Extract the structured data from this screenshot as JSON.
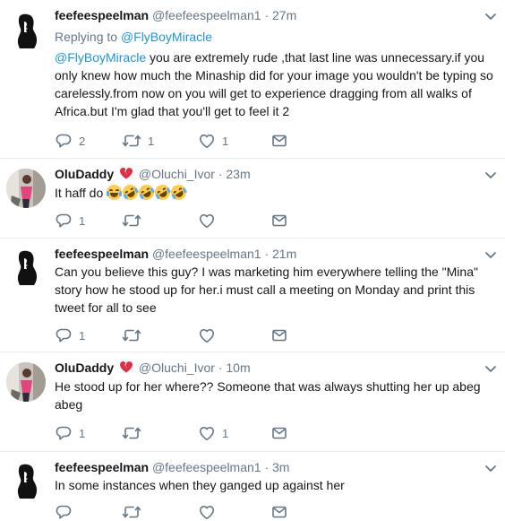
{
  "tweets": [
    {
      "name": "feefeespeelman",
      "handle": "@feefeespeelman1",
      "time": "· 27m",
      "replying_label": "Replying to",
      "replying_user": "@FlyBoyMiracle",
      "mention": "@FlyBoyMiracle",
      "text": " you are extremely rude ,that last line was unnecessary.if you only knew how much the Minaship did for your image you wouldn't be typing so carelessly.from now on you will get to experience dragging from all walks of Africa.but I'm glad that you'll get to feel it 2",
      "replies": "2",
      "retweets": "1",
      "likes": "1"
    },
    {
      "name": "OluDaddy",
      "handle": "@Oluchi_Ivor",
      "time": "· 23m",
      "text": "It haff do",
      "replies": "1",
      "retweets": "",
      "likes": ""
    },
    {
      "name": "feefeespeelman",
      "handle": "@feefeespeelman1",
      "time": "· 21m",
      "text": "Can you believe this guy? I was marketing him everywhere telling the \"Mina\" story how he stood up for her.i must call a meeting on Monday and print this tweet for all to see",
      "replies": "1",
      "retweets": "",
      "likes": ""
    },
    {
      "name": "OluDaddy",
      "handle": "@Oluchi_Ivor",
      "time": "· 10m",
      "text": "He stood up for her where?? Someone that was always shutting her up  abeg abeg",
      "replies": "1",
      "retweets": "",
      "likes": "1"
    },
    {
      "name": "feefeespeelman",
      "handle": "@feefeespeelman1",
      "time": "· 3m",
      "text": "In some instances when they ganged up against her",
      "replies": "",
      "retweets": "",
      "likes": ""
    }
  ],
  "icons": {
    "reply": "reply-icon",
    "retweet": "retweet-icon",
    "like": "like-icon",
    "dm": "direct-message-icon",
    "menu": "chevron-down-icon",
    "broken_heart": "broken-heart-icon"
  },
  "colors": {
    "link": "#1b95e0",
    "secondary_text": "#657786",
    "divider": "#e6ecf0",
    "broken_heart": "#dd2e44"
  }
}
